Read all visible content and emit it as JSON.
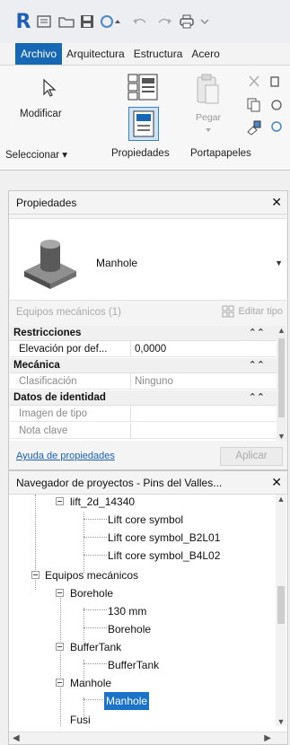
{
  "ribbon": {
    "tabs": [
      "Archivo",
      "Arquitectura",
      "Estructura",
      "Acero"
    ],
    "modify_label": "Modificar",
    "paste_label": "Pegar",
    "groups": {
      "select": "Seleccionar",
      "select_caret": "▾",
      "properties": "Propiedades",
      "clipboard": "Portapapeles"
    }
  },
  "properties": {
    "title": "Propiedades",
    "type_name": "Manhole",
    "selection": "Equipos mecánicos (1)",
    "edit_type": "Editar tipo",
    "sections": [
      {
        "name": "Restricciones",
        "rows": [
          {
            "name": "Elevación por def...",
            "value": "0,0000",
            "dim": false
          }
        ]
      },
      {
        "name": "Mecánica",
        "rows": [
          {
            "name": "Clasificación",
            "value": "Ninguno",
            "dim": true
          }
        ]
      },
      {
        "name": "Datos de identidad",
        "rows": [
          {
            "name": "Imagen de tipo",
            "value": "",
            "dim": true
          },
          {
            "name": "Nota clave",
            "value": "",
            "dim": true
          }
        ]
      }
    ],
    "help_link": "Ayuda de propiedades",
    "apply_label": "Aplicar"
  },
  "browser": {
    "title": "Navegador de proyectos - Pins del Valles...",
    "items": [
      {
        "label": "lift_2d_14340",
        "expanded": true
      },
      {
        "label": "Lift core symbol"
      },
      {
        "label": "Lift core symbol_B2L01"
      },
      {
        "label": "Lift core symbol_B4L02"
      },
      {
        "label": "Equipos mecánicos",
        "expanded": true
      },
      {
        "label": "Borehole",
        "expanded": true
      },
      {
        "label": "130 mm"
      },
      {
        "label": "Borehole"
      },
      {
        "label": "BufferTank",
        "expanded": true
      },
      {
        "label": "BufferTank"
      },
      {
        "label": "Manhole",
        "expanded": true
      },
      {
        "label": "Manhole",
        "selected": true
      },
      {
        "label": "Fusi"
      }
    ]
  },
  "colors": {
    "accent": "#1668b5",
    "selection": "#1a73c9",
    "link": "#1a5fb4"
  },
  "icons": [
    "revit-logo",
    "open-icon",
    "save-icon",
    "sync-icon",
    "undo-icon",
    "redo-icon",
    "print-icon",
    "modify-cursor-icon",
    "type-selector-icon",
    "properties-icon",
    "paste-icon",
    "cut-icon",
    "copy-icon",
    "match-properties-icon",
    "close-icon",
    "chevron-down-icon",
    "edit-type-icon"
  ]
}
